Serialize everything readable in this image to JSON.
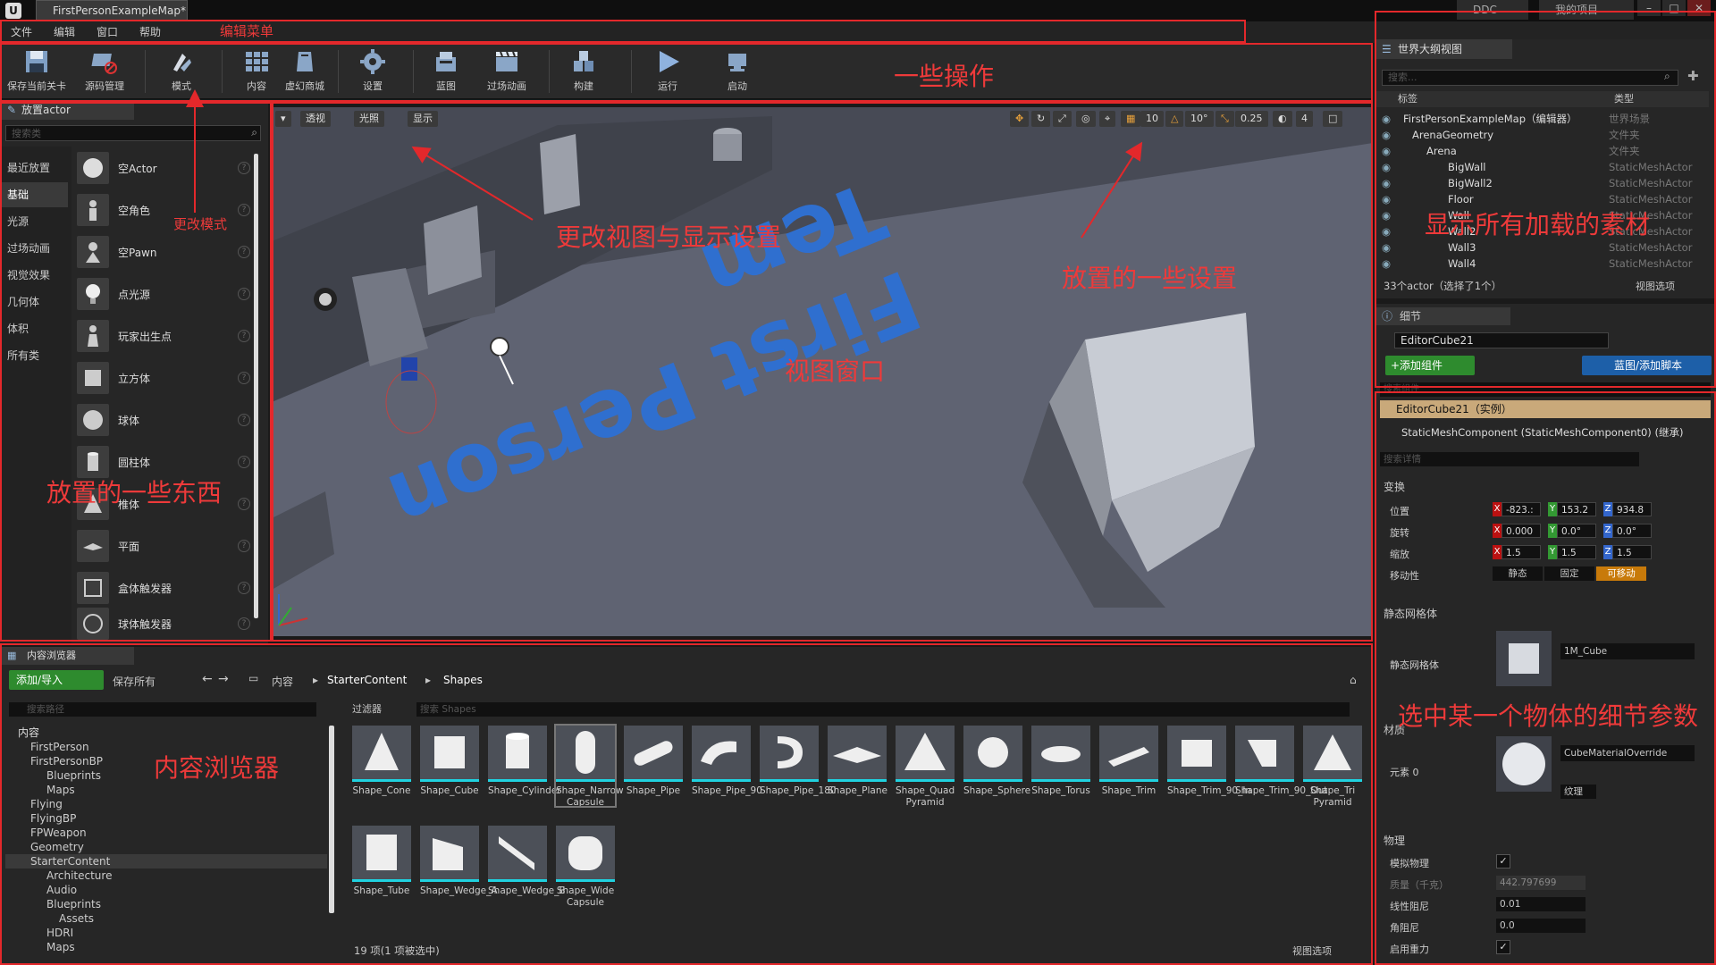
{
  "titlebar": {
    "logo": "U",
    "tab": "FirstPersonExampleMap*",
    "right_tabs": [
      "DDC",
      "我的项目"
    ],
    "window_buttons": [
      "–",
      "□",
      "✕"
    ]
  },
  "menu": [
    "文件",
    "编辑",
    "窗口",
    "帮助"
  ],
  "toolbar": [
    {
      "label": "保存当前关卡",
      "icon": "save-icon"
    },
    {
      "label": "源码管理",
      "icon": "source-control-icon"
    },
    {
      "label": "模式",
      "icon": "modes-icon"
    },
    {
      "label": "内容",
      "icon": "content-icon"
    },
    {
      "label": "虚幻商城",
      "icon": "marketplace-icon"
    },
    {
      "label": "设置",
      "icon": "settings-icon"
    },
    {
      "label": "蓝图",
      "icon": "blueprint-icon"
    },
    {
      "label": "过场动画",
      "icon": "cinematics-icon"
    },
    {
      "label": "构建",
      "icon": "build-icon"
    },
    {
      "label": "运行",
      "icon": "play-icon"
    },
    {
      "label": "启动",
      "icon": "launch-icon"
    }
  ],
  "place_panel": {
    "tab": "放置actor",
    "search_placeholder": "搜索类",
    "categories": [
      "最近放置",
      "基础",
      "光源",
      "过场动画",
      "视觉效果",
      "几何体",
      "体积",
      "所有类"
    ],
    "selected_category": "基础",
    "items": [
      "空Actor",
      "空角色",
      "空Pawn",
      "点光源",
      "玩家出生点",
      "立方体",
      "球体",
      "圆柱体",
      "椎体",
      "平面",
      "盒体触发器",
      "球体触发器"
    ]
  },
  "viewport": {
    "left_buttons": [
      "透视",
      "光照",
      "显示"
    ],
    "snap_values": [
      "10",
      "10°",
      "0.25",
      "4"
    ],
    "floor_text": "First Person Tem"
  },
  "outliner": {
    "tab": "世界大纲视图",
    "search_placeholder": "搜索...",
    "columns": [
      "标签",
      "类型"
    ],
    "rows": [
      {
        "name": "FirstPersonExampleMap（编辑器）",
        "type": "世界场景",
        "indent": 0
      },
      {
        "name": "ArenaGeometry",
        "type": "文件夹",
        "indent": 1
      },
      {
        "name": "Arena",
        "type": "文件夹",
        "indent": 2
      },
      {
        "name": "BigWall",
        "type": "StaticMeshActor",
        "indent": 3
      },
      {
        "name": "BigWall2",
        "type": "StaticMeshActor",
        "indent": 3
      },
      {
        "name": "Floor",
        "type": "StaticMeshActor",
        "indent": 3
      },
      {
        "name": "Wall",
        "type": "StaticMeshActor",
        "indent": 3
      },
      {
        "name": "Wall2",
        "type": "StaticMeshActor",
        "indent": 3
      },
      {
        "name": "Wall3",
        "type": "StaticMeshActor",
        "indent": 3
      },
      {
        "name": "Wall4",
        "type": "StaticMeshActor",
        "indent": 3
      }
    ],
    "footer": "33个actor（选择了1个）",
    "view_options": "视图选项"
  },
  "details": {
    "tab": "细节",
    "name": "EditorCube21",
    "add_component": "+添加组件",
    "blueprint_button": "蓝图/添加脚本",
    "search_components_placeholder": "搜索组件",
    "instance_label": "EditorCube21（实例）",
    "component_label": "StaticMeshComponent (StaticMeshComponent0) (继承)",
    "search_details_placeholder": "搜索详情",
    "transform_header": "变换",
    "location_label": "位置",
    "rotation_label": "旋转",
    "scale_label": "缩放",
    "mobility_label": "移动性",
    "location": [
      "-823.:",
      "153.2",
      "934.8"
    ],
    "rotation": [
      "0.000",
      "0.0°",
      "0.0°"
    ],
    "scale": [
      "1.5",
      "1.5",
      "1.5"
    ],
    "mobility": [
      "静态",
      "固定",
      "可移动"
    ],
    "static_mesh_header": "静态网格体",
    "static_mesh_label": "静态网格体",
    "static_mesh_value": "1M_Cube",
    "materials_header": "材质",
    "element0_label": "元素 0",
    "material_value": "CubeMaterialOverride",
    "texture_button": "纹理",
    "physics_header": "物理",
    "simulate_physics": "模拟物理",
    "mass_label": "质量（千克）",
    "mass_value": "442.797699",
    "linear_damping_label": "线性阻尼",
    "linear_damping_value": "0.01",
    "angular_damping_label": "角阻尼",
    "angular_damping_value": "0.0",
    "enable_gravity_label": "启用重力"
  },
  "content_browser": {
    "tab": "内容浏览器",
    "add_import": "添加/导入",
    "save_all": "保存所有",
    "breadcrumb": [
      "内容",
      "StarterContent",
      "Shapes"
    ],
    "search_paths_placeholder": "搜索路径",
    "filters": "过滤器",
    "search_assets_placeholder": "搜索 Shapes",
    "tree": [
      {
        "name": "内容",
        "indent": 0
      },
      {
        "name": "FirstPerson",
        "indent": 1
      },
      {
        "name": "FirstPersonBP",
        "indent": 1
      },
      {
        "name": "Blueprints",
        "indent": 2
      },
      {
        "name": "Maps",
        "indent": 2
      },
      {
        "name": "Flying",
        "indent": 1
      },
      {
        "name": "FlyingBP",
        "indent": 1
      },
      {
        "name": "FPWeapon",
        "indent": 1
      },
      {
        "name": "Geometry",
        "indent": 1
      },
      {
        "name": "StarterContent",
        "indent": 1
      },
      {
        "name": "Architecture",
        "indent": 2
      },
      {
        "name": "Audio",
        "indent": 2
      },
      {
        "name": "Blueprints",
        "indent": 2
      },
      {
        "name": "Assets",
        "indent": 3
      },
      {
        "name": "HDRI",
        "indent": 2
      },
      {
        "name": "Maps",
        "indent": 2
      }
    ],
    "assets": [
      {
        "name": "Shape_Cone",
        "shape": "cone"
      },
      {
        "name": "Shape_Cube",
        "shape": "cube"
      },
      {
        "name": "Shape_Cylinder",
        "shape": "cylinder"
      },
      {
        "name": "Shape_Narrow Capsule",
        "shape": "capsule"
      },
      {
        "name": "Shape_Pipe",
        "shape": "pipe"
      },
      {
        "name": "Shape_Pipe_90",
        "shape": "pipe90"
      },
      {
        "name": "Shape_Pipe_180",
        "shape": "pipe180"
      },
      {
        "name": "Shape_Plane",
        "shape": "plane"
      },
      {
        "name": "Shape_Quad Pyramid",
        "shape": "pyramid"
      },
      {
        "name": "Shape_Sphere",
        "shape": "sphere"
      },
      {
        "name": "Shape_Torus",
        "shape": "torus"
      },
      {
        "name": "Shape_Trim",
        "shape": "trim"
      },
      {
        "name": "Shape_Trim_90_In",
        "shape": "trim90in"
      },
      {
        "name": "Shape_Trim_90_Out",
        "shape": "trim90out"
      },
      {
        "name": "Shape_Tri Pyramid",
        "shape": "tripyramid"
      },
      {
        "name": "Shape_Tube",
        "shape": "tube"
      },
      {
        "name": "Shape_Wedge_A",
        "shape": "wedgea"
      },
      {
        "name": "Shape_Wedge_B",
        "shape": "wedgeb"
      },
      {
        "name": "Shape_Wide Capsule",
        "shape": "widecapsule"
      }
    ],
    "selected_asset": "Shape_Narrow Capsule",
    "status": "19 项(1 项被选中)",
    "view_options": "视图选项"
  },
  "annotations": {
    "edit_menu": "编辑菜单",
    "operations": "一些操作",
    "change_mode": "更改模式",
    "view_display": "更改视图与显示设置",
    "place_settings": "放置的一些设置",
    "viewport": "视图窗口",
    "place_things": "放置的一些东西",
    "show_assets": "显示所有加载的素材",
    "content_browser": "内容浏览器",
    "details_params": "选中某一个物体的细节参数"
  },
  "colors": {
    "annotation_red": "#e3282b",
    "cyan_accent": "#1fd2e0",
    "green_button": "#2e8b2e",
    "blue_button": "#1d5fa8",
    "orange_mobility": "#c87a0a"
  }
}
